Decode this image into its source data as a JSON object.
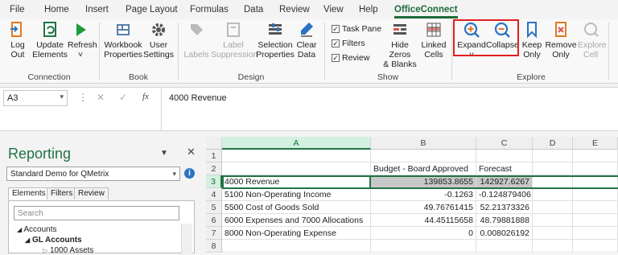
{
  "tabs": [
    "File",
    "Home",
    "Insert",
    "Page Layout",
    "Formulas",
    "Data",
    "Review",
    "View",
    "Help",
    "OfficeConnect"
  ],
  "ribbon": {
    "connection": {
      "label": "Connection",
      "log_out": [
        "Log",
        "Out"
      ],
      "update": [
        "Update",
        "Elements"
      ],
      "refresh": [
        "Refresh",
        "˅"
      ]
    },
    "book": {
      "label": "Book",
      "workbook": [
        "Workbook",
        "Properties"
      ],
      "user": [
        "User",
        "Settings"
      ]
    },
    "design": {
      "label": "Design",
      "labels": "Labels",
      "suppression": [
        "Label",
        "Suppression"
      ],
      "selection": [
        "Selection",
        "Properties"
      ],
      "clear": [
        "Clear",
        "Data"
      ]
    },
    "show": {
      "label": "Show",
      "task_pane": "Task Pane",
      "filters": "Filters",
      "review": "Review",
      "hide_zeros": [
        "Hide Zeros",
        "& Blanks"
      ],
      "linked": [
        "Linked",
        "Cells"
      ]
    },
    "explore": {
      "label": "Explore",
      "expand": "Expand",
      "collapse": "Collapse",
      "keep": [
        "Keep",
        "Only"
      ],
      "remove": [
        "Remove",
        "Only"
      ],
      "explore_cell": [
        "Explore",
        "Cell"
      ]
    }
  },
  "formula": {
    "name_box": "A3",
    "fx": "fx",
    "value": "4000 Revenue"
  },
  "pane": {
    "title": "Reporting",
    "dropdown": "Standard Demo for QMetrix",
    "tabs": [
      "Elements",
      "Filters",
      "Review"
    ],
    "search_placeholder": "Search",
    "tree": [
      "Accounts",
      "GL Accounts",
      "1000 Assets"
    ]
  },
  "sheet": {
    "columns": [
      "A",
      "B",
      "C",
      "D",
      "E"
    ],
    "rows": [
      "1",
      "2",
      "3",
      "4",
      "5",
      "6",
      "7",
      "8"
    ],
    "header_row": {
      "b": "Budget - Board Approved",
      "c": "Forecast"
    },
    "data": [
      {
        "a": "4000 Revenue",
        "b": "139853.8655",
        "c": "142927.6267"
      },
      {
        "a": "5100 Non-Operating Income",
        "b": "-0.1263",
        "c": "-0.124879406"
      },
      {
        "a": "5500 Cost of Goods Sold",
        "b": "49.76761415",
        "c": "52.21373326"
      },
      {
        "a": "6000 Expenses and 7000 Allocations",
        "b": "44.45115658",
        "c": "48.79881888"
      },
      {
        "a": "8000 Non-Operating Expense",
        "b": "0",
        "c": "0.008026192"
      }
    ]
  },
  "colors": {
    "accent": "#217346",
    "highlight": "#e02020",
    "expand_icon": "#2b73c3"
  }
}
